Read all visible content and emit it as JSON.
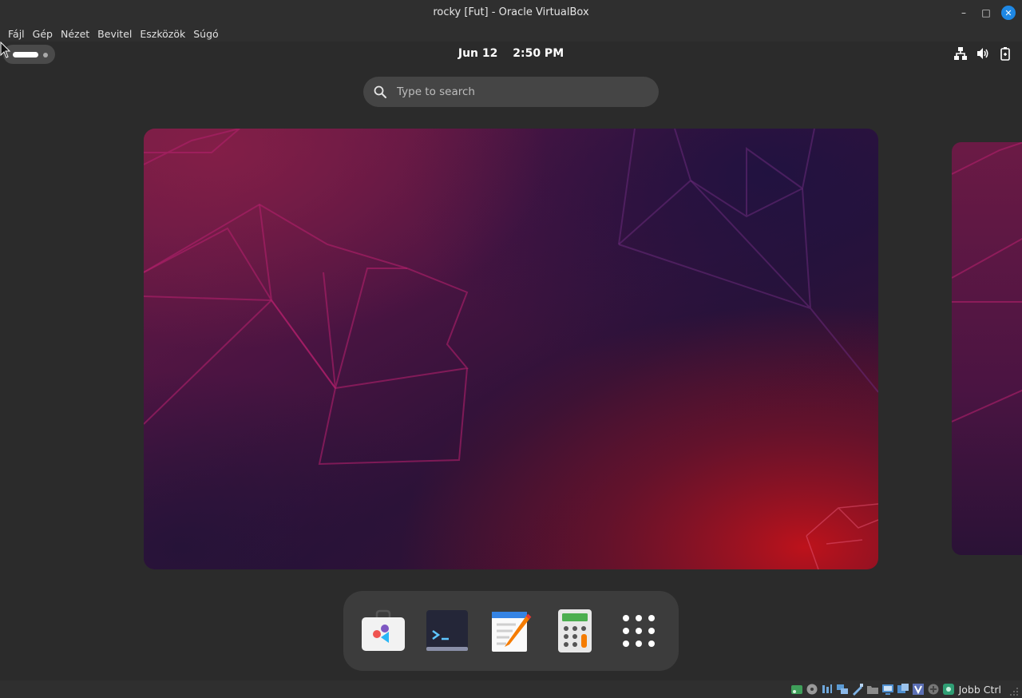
{
  "window": {
    "title": "rocky [Fut] - Oracle VirtualBox",
    "minimize_label": "–",
    "maximize_label": "□",
    "close_label": "✕"
  },
  "menubar": {
    "items": [
      "Fájl",
      "Gép",
      "Nézet",
      "Bevitel",
      "Eszközök",
      "Súgó"
    ]
  },
  "gnome": {
    "date": "Jun 12",
    "time": "2:50 PM",
    "tray_icons": [
      "network-icon",
      "volume-icon",
      "battery-icon"
    ],
    "search_placeholder": "Type to search",
    "dock_apps": [
      {
        "name": "software-store",
        "icon": "shopping-bag-icon"
      },
      {
        "name": "terminal",
        "icon": "terminal-icon",
        "glyph": ">_"
      },
      {
        "name": "text-editor",
        "icon": "text-editor-icon"
      },
      {
        "name": "calculator",
        "icon": "calculator-icon"
      },
      {
        "name": "show-apps",
        "icon": "app-grid-icon"
      }
    ]
  },
  "statusbar": {
    "host_key": "Jobb Ctrl",
    "icons": [
      "hard-disk-icon",
      "optical-drive-icon",
      "audio-icon",
      "network-icon",
      "usb-icon",
      "shared-folders-icon",
      "display-icon",
      "video-capture-icon",
      "recording-icon",
      "cpu-icon",
      "mouse-integration-icon",
      "host-key-icon"
    ]
  },
  "colors": {
    "accent_close": "#1e88e5",
    "wallpaper_top": "#3a1240",
    "wallpaper_accent": "#b0161e"
  }
}
